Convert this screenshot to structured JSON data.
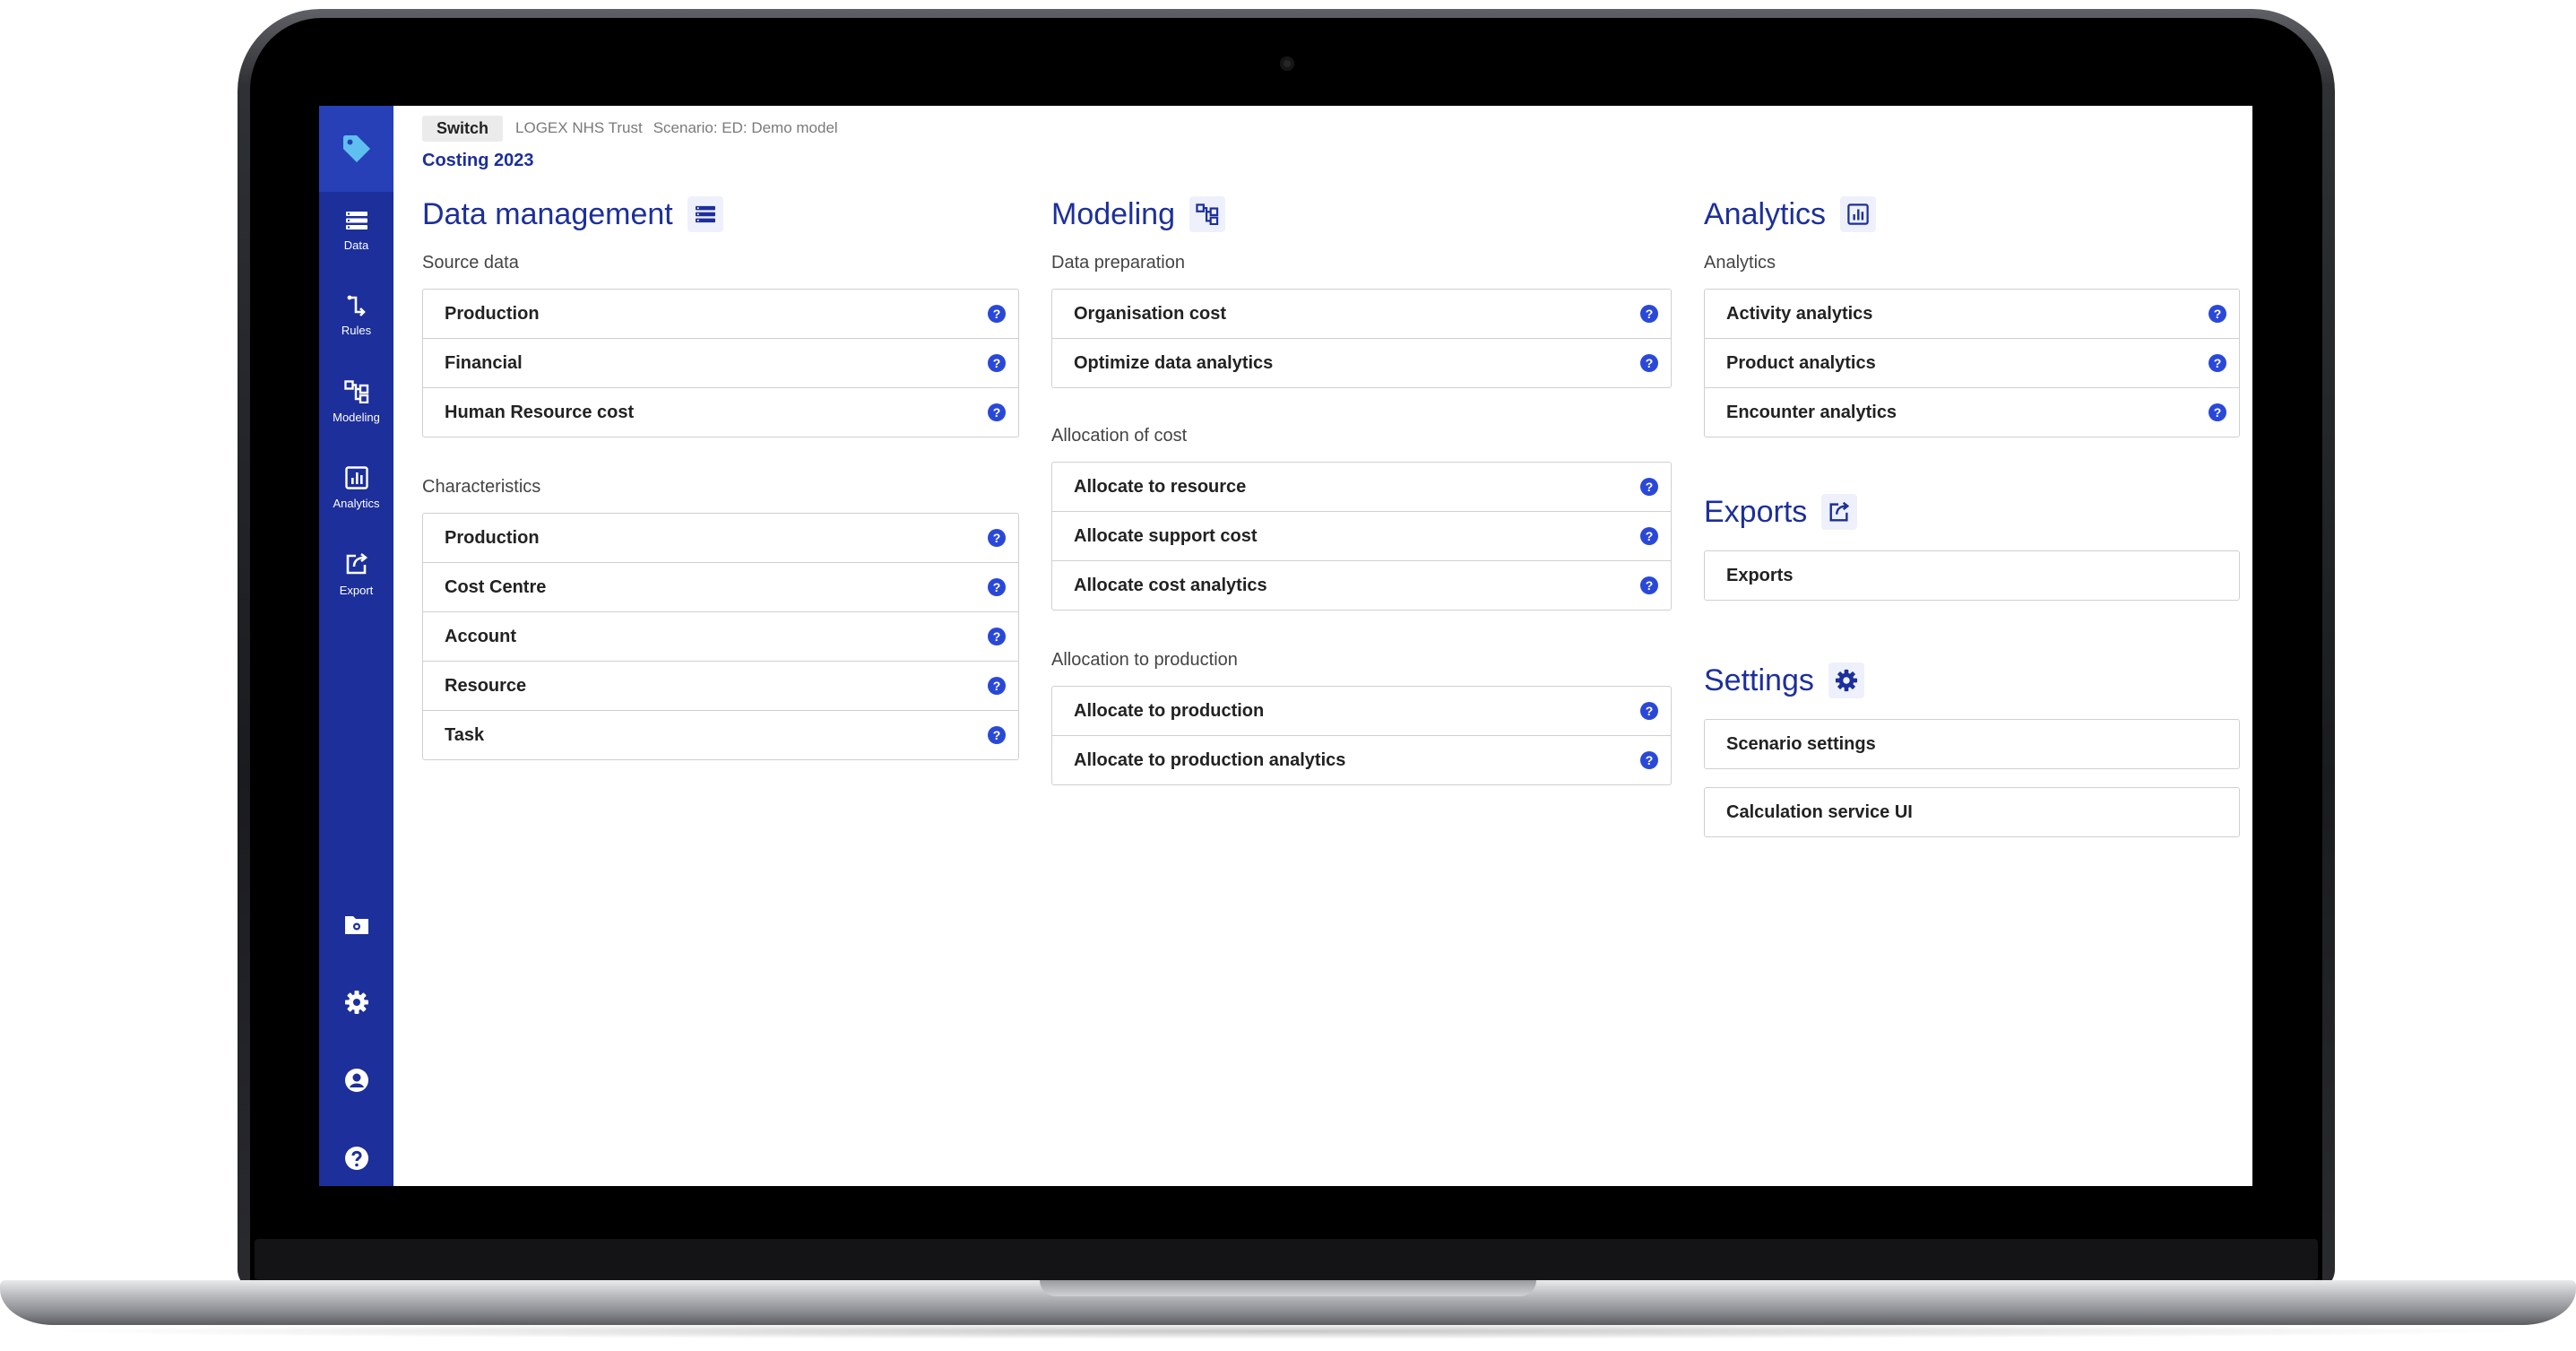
{
  "header": {
    "switch_label": "Switch",
    "organisation": "LOGEX NHS Trust",
    "scenario": "Scenario: ED: Demo model",
    "costing": "Costing 2023"
  },
  "sidebar": {
    "logo_icon": "tag-icon",
    "items": [
      {
        "label": "Data",
        "icon": "list-icon"
      },
      {
        "label": "Rules",
        "icon": "rules-icon"
      },
      {
        "label": "Modeling",
        "icon": "hierarchy-icon"
      },
      {
        "label": "Analytics",
        "icon": "bar-chart-icon"
      },
      {
        "label": "Export",
        "icon": "export-icon"
      }
    ],
    "bottom_icons": [
      "folder-settings-icon",
      "gear-icon",
      "user-icon",
      "help-icon"
    ],
    "accent_color": "#1c2f9b"
  },
  "data_management": {
    "title": "Data management",
    "groups": [
      {
        "label": "Source data",
        "items": [
          "Production",
          "Financial",
          "Human Resource cost"
        ]
      },
      {
        "label": "Characteristics",
        "items": [
          "Production",
          "Cost Centre",
          "Account",
          "Resource",
          "Task"
        ]
      }
    ]
  },
  "modeling": {
    "title": "Modeling",
    "groups": [
      {
        "label": "Data preparation",
        "items": [
          "Organisation cost",
          "Optimize data analytics"
        ]
      },
      {
        "label": "Allocation of cost",
        "items": [
          "Allocate to resource",
          "Allocate support cost",
          "Allocate cost analytics"
        ]
      },
      {
        "label": "Allocation to production",
        "items": [
          "Allocate to production",
          "Allocate to production analytics"
        ]
      }
    ]
  },
  "analytics": {
    "title": "Analytics",
    "group_label": "Analytics",
    "items": [
      "Activity analytics",
      "Product analytics",
      "Encounter analytics"
    ]
  },
  "exports": {
    "title": "Exports",
    "items": [
      "Exports"
    ]
  },
  "settings": {
    "title": "Settings",
    "items": [
      "Scenario settings",
      "Calculation service UI"
    ]
  },
  "help_glyph": "?"
}
